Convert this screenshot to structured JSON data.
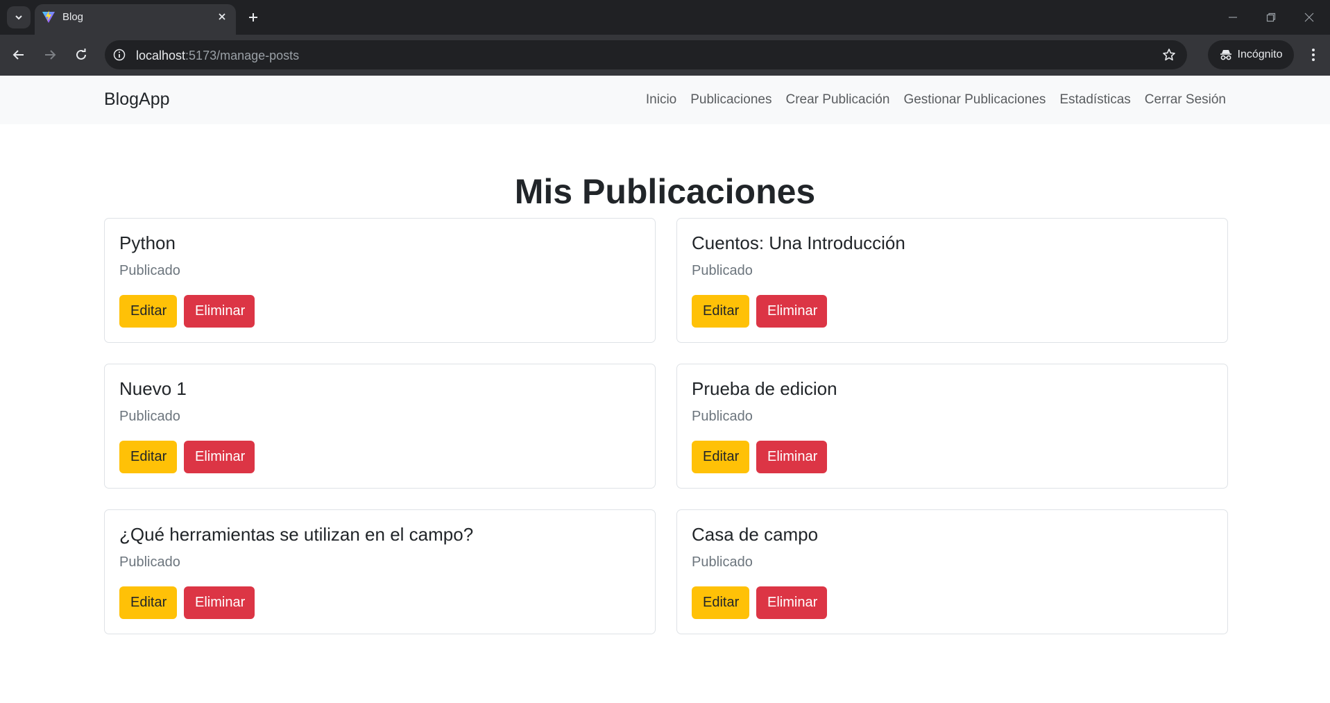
{
  "browser": {
    "tab_title": "Blog",
    "url_host": "localhost",
    "url_path": ":5173/manage-posts",
    "incognito_label": "Incógnito"
  },
  "navbar": {
    "brand": "BlogApp",
    "links": [
      "Inicio",
      "Publicaciones",
      "Crear Publicación",
      "Gestionar Publicaciones",
      "Estadísticas",
      "Cerrar Sesión"
    ]
  },
  "main": {
    "title": "Mis Publicaciones",
    "posts": [
      {
        "title": "Python",
        "status": "Publicado",
        "edit_label": "Editar",
        "delete_label": "Eliminar"
      },
      {
        "title": "Cuentos: Una Introducción",
        "status": "Publicado",
        "edit_label": "Editar",
        "delete_label": "Eliminar"
      },
      {
        "title": "Nuevo 1",
        "status": "Publicado",
        "edit_label": "Editar",
        "delete_label": "Eliminar"
      },
      {
        "title": "Prueba de edicion",
        "status": "Publicado",
        "edit_label": "Editar",
        "delete_label": "Eliminar"
      },
      {
        "title": "¿Qué herramientas se utilizan en el campo?",
        "status": "Publicado",
        "edit_label": "Editar",
        "delete_label": "Eliminar"
      },
      {
        "title": "Casa de campo",
        "status": "Publicado",
        "edit_label": "Editar",
        "delete_label": "Eliminar"
      }
    ]
  },
  "colors": {
    "edit_button": "#ffc107",
    "delete_button": "#dc3545",
    "navbar_bg": "#f8f9fa"
  }
}
